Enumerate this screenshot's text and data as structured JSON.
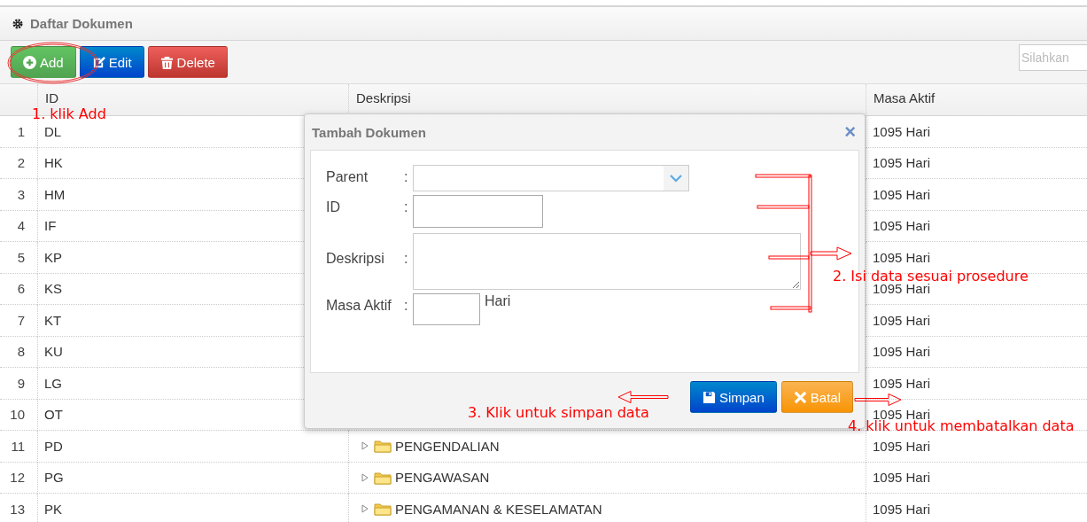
{
  "panel": {
    "title": "Daftar Dokumen"
  },
  "toolbar": {
    "buttons": [
      {
        "label": "Add",
        "kind": "add"
      },
      {
        "label": "Edit",
        "kind": "edit"
      },
      {
        "label": "Delete",
        "kind": "delete"
      }
    ],
    "search": {
      "placeholder": "Silahkan"
    }
  },
  "table": {
    "columns": [
      "ID",
      "Deskripsi",
      "Masa Aktif"
    ],
    "rows": [
      {
        "number": "1",
        "id": "DL",
        "masa_aktif": "1095 Hari"
      },
      {
        "number": "2",
        "id": "HK",
        "masa_aktif": "1095 Hari"
      },
      {
        "number": "3",
        "id": "HM",
        "masa_aktif": "1095 Hari"
      },
      {
        "number": "4",
        "id": "IF",
        "masa_aktif": "1095 Hari"
      },
      {
        "number": "5",
        "id": "KP",
        "masa_aktif": "1095 Hari"
      },
      {
        "number": "6",
        "id": "KS",
        "masa_aktif": "1095 Hari"
      },
      {
        "number": "7",
        "id": "KT",
        "masa_aktif": "1095 Hari"
      },
      {
        "number": "8",
        "id": "KU",
        "masa_aktif": "1095 Hari"
      },
      {
        "number": "9",
        "id": "LG",
        "masa_aktif": "1095 Hari"
      },
      {
        "number": "10",
        "id": "OT",
        "masa_aktif": "1095 Hari"
      },
      {
        "number": "11",
        "id": "PD",
        "description": "PENGENDALIAN",
        "masa_aktif": "1095 Hari"
      },
      {
        "number": "12",
        "id": "PG",
        "description": "PENGAWASAN",
        "masa_aktif": "1095 Hari"
      },
      {
        "number": "13",
        "id": "PK",
        "description": "PENGAMANAN & KESELAMATAN",
        "masa_aktif": "1095 Hari"
      }
    ]
  },
  "dialog": {
    "title": "Tambah Dokumen",
    "close": "×",
    "fields": [
      {
        "label": "Parent",
        "separator": ":",
        "kind": "select"
      },
      {
        "label": "ID",
        "separator": ":",
        "kind": "input"
      },
      {
        "label": "Deskripsi",
        "separator": ":",
        "kind": "textarea"
      },
      {
        "label": "Masa Aktif",
        "separator": ":",
        "kind": "unit",
        "unit": "Hari"
      }
    ],
    "buttons": [
      {
        "label": "Simpan",
        "kind": "save"
      },
      {
        "label": "Batal",
        "kind": "cancel"
      }
    ]
  },
  "annotations": [
    {
      "text": "1. klik Add"
    },
    {
      "text": "2. Isi data sesuai prosedure"
    },
    {
      "text": "3. Klik untuk simpan data"
    },
    {
      "text": "4. klik untuk membatalkan data"
    }
  ]
}
